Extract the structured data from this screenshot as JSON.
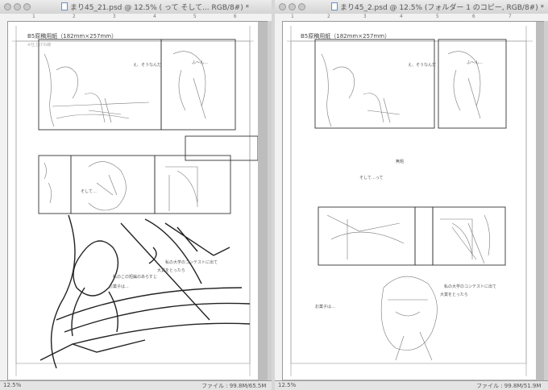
{
  "left_window": {
    "title": "まり45_21.psd @ 12.5% ( って そして... RGB/8#) *",
    "page_label": "B5原稿用紙（182mm×257mm）",
    "note": "※仕上げの線",
    "ruler_marks": [
      "1",
      "2",
      "3",
      "4",
      "5",
      "6"
    ],
    "zoom": "12.5%",
    "status": "ファイル : 99.8M/65.5M"
  },
  "right_window": {
    "title": "まり45_2.psd @ 12.5% (フォルダー 1 のコピー, RGB/8#) *",
    "page_label": "B5原稿用紙（182mm×257mm）",
    "ruler_marks": [
      "1",
      "2",
      "3",
      "4",
      "5",
      "6",
      "7"
    ],
    "zoom": "12.5%",
    "status": "ファイル : 99.8M/51.9M"
  }
}
